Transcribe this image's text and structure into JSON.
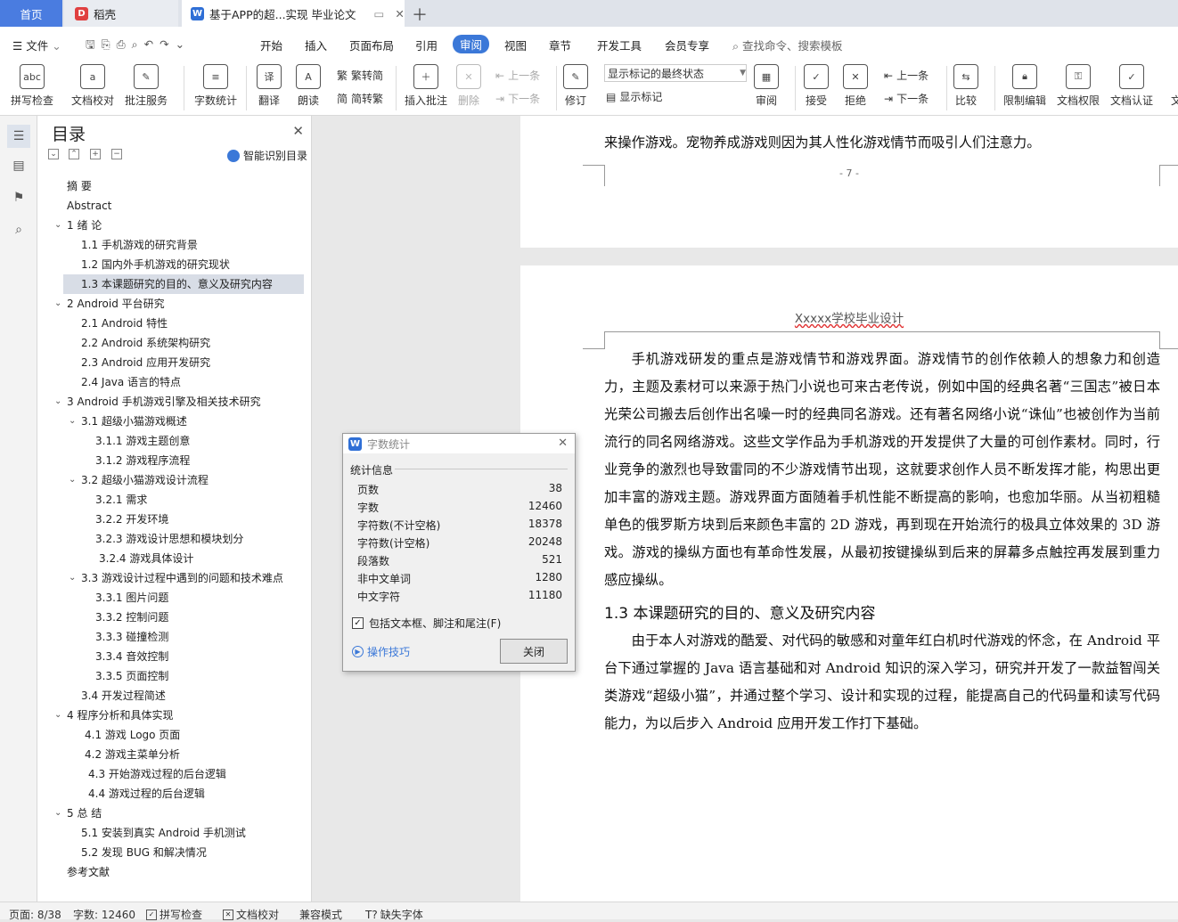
{
  "tabs": {
    "home": "首页",
    "daoke": "稻壳",
    "doc": "基于APP的超...实现 毕业论文"
  },
  "menu": {
    "file": "文件",
    "items": [
      "开始",
      "插入",
      "页面布局",
      "引用",
      "审阅",
      "视图",
      "章节",
      "开发工具",
      "会员专享"
    ],
    "search": "查找命令、搜索模板"
  },
  "ribbon": {
    "spell": "拼写检查",
    "proof": "文档校对",
    "annotate_service": "批注服务",
    "wordcount": "字数统计",
    "translate": "翻译",
    "read": "朗读",
    "to_trad": "繁转简",
    "to_simp": "简转繁",
    "insert_comment": "插入批注",
    "delete": "删除",
    "prev": "上一条",
    "next": "下一条",
    "revise": "修订",
    "markup_state": "显示标记的最终状态",
    "show_markup": "显示标记",
    "review": "审阅",
    "accept": "接受",
    "reject": "拒绝",
    "prev2": "上一条",
    "next2": "下一条",
    "compare": "比较",
    "restrict": "限制编辑",
    "doc_rights": "文档权限",
    "doc_cert": "文档认证",
    "more": "文"
  },
  "toc": {
    "title": "目录",
    "smart": "智能识别目录",
    "items": [
      "摘 要",
      "Abstract",
      "1 绪 论",
      "1.1 手机游戏的研究背景",
      "1.2 国内外手机游戏的研究现状",
      "1.3 本课题研究的目的、意义及研究内容",
      "2 Android 平台研究",
      "2.1 Android 特性",
      "2.2 Android 系统架构研究",
      "2.3 Android 应用开发研究",
      "2.4 Java 语言的特点",
      "3 Android 手机游戏引擎及相关技术研究",
      "3.1 超级小猫游戏概述",
      "3.1.1 游戏主题创意",
      "3.1.2 游戏程序流程",
      "3.2 超级小猫游戏设计流程",
      "3.2.1 需求",
      "3.2.2 开发环境",
      "3.2.3 游戏设计思想和模块划分",
      "3.2.4 游戏具体设计",
      "3.3 游戏设计过程中遇到的问题和技术难点",
      "3.3.1 图片问题",
      "3.3.2 控制问题",
      "3.3.3 碰撞检测",
      "3.3.4 音效控制",
      "3.3.5 页面控制",
      "3.4 开发过程简述",
      "4 程序分析和具体实现",
      "4.1 游戏 Logo 页面",
      "4.2 游戏主菜单分析",
      "4.3 开始游戏过程的后台逻辑",
      "4.4 游戏过程的后台逻辑",
      "5 总 结",
      "5.1 安装到真实 Android 手机测试",
      "5.2 发现 BUG 和解决情况",
      "参考文献"
    ]
  },
  "doc": {
    "page1_text": "来操作游戏。宠物养成游戏则因为其人性化游戏情节而吸引人们注意力。",
    "page_number": "- 7 -",
    "header": "Xxxxx学校毕业设计",
    "para1": "手机游戏研发的重点是游戏情节和游戏界面。游戏情节的创作依赖人的想象力和创造力，主题及素材可以来源于热门小说也可来古老传说，例如中国的经典名著“三国志”被日本光荣公司搬去后创作出名噪一时的经典同名游戏。还有著名网络小说“诛仙”也被创作为当前流行的同名网络游戏。这些文学作品为手机游戏的开发提供了大量的可创作素材。同时，行业竞争的激烈也导致雷同的不少游戏情节出现，这就要求创作人员不断发挥才能，构思出更加丰富的游戏主题。游戏界面方面随着手机性能不断提高的影响，也愈加华丽。从当初粗糙单色的俄罗斯方块到后来颜色丰富的 2D 游戏，再到现在开始流行的极具立体效果的 3D 游戏。游戏的操纵方面也有革命性发展，从最初按键操纵到后来的屏幕多点触控再发展到重力感应操纵。",
    "heading": "1.3 本课题研究的目的、意义及研究内容",
    "para2": "由于本人对游戏的酷爱、对代码的敏感和对童年红白机时代游戏的怀念，在 Android 平台下通过掌握的 Java 语言基础和对 Android 知识的深入学习，研究并开发了一款益智闯关类游戏“超级小猫”，并通过整个学习、设计和实现的过程，能提高自己的代码量和读写代码能力，为以后步入 Android 应用开发工作打下基础。"
  },
  "dialog": {
    "title": "字数统计",
    "section": "统计信息",
    "rows": [
      {
        "label": "页数",
        "value": "38"
      },
      {
        "label": "字数",
        "value": "12460"
      },
      {
        "label": "字符数(不计空格)",
        "value": "18378"
      },
      {
        "label": "字符数(计空格)",
        "value": "20248"
      },
      {
        "label": "段落数",
        "value": "521"
      },
      {
        "label": "非中文单词",
        "value": "1280"
      },
      {
        "label": "中文字符",
        "value": "11180"
      }
    ],
    "checkbox": "包括文本框、脚注和尾注(F)",
    "tips": "操作技巧",
    "close": "关闭"
  },
  "status": {
    "page": "页面: 8/38",
    "words": "字数: 12460",
    "spell": "拼写检查",
    "proof": "文档校对",
    "compat": "兼容模式",
    "missing_font": "缺失字体"
  }
}
